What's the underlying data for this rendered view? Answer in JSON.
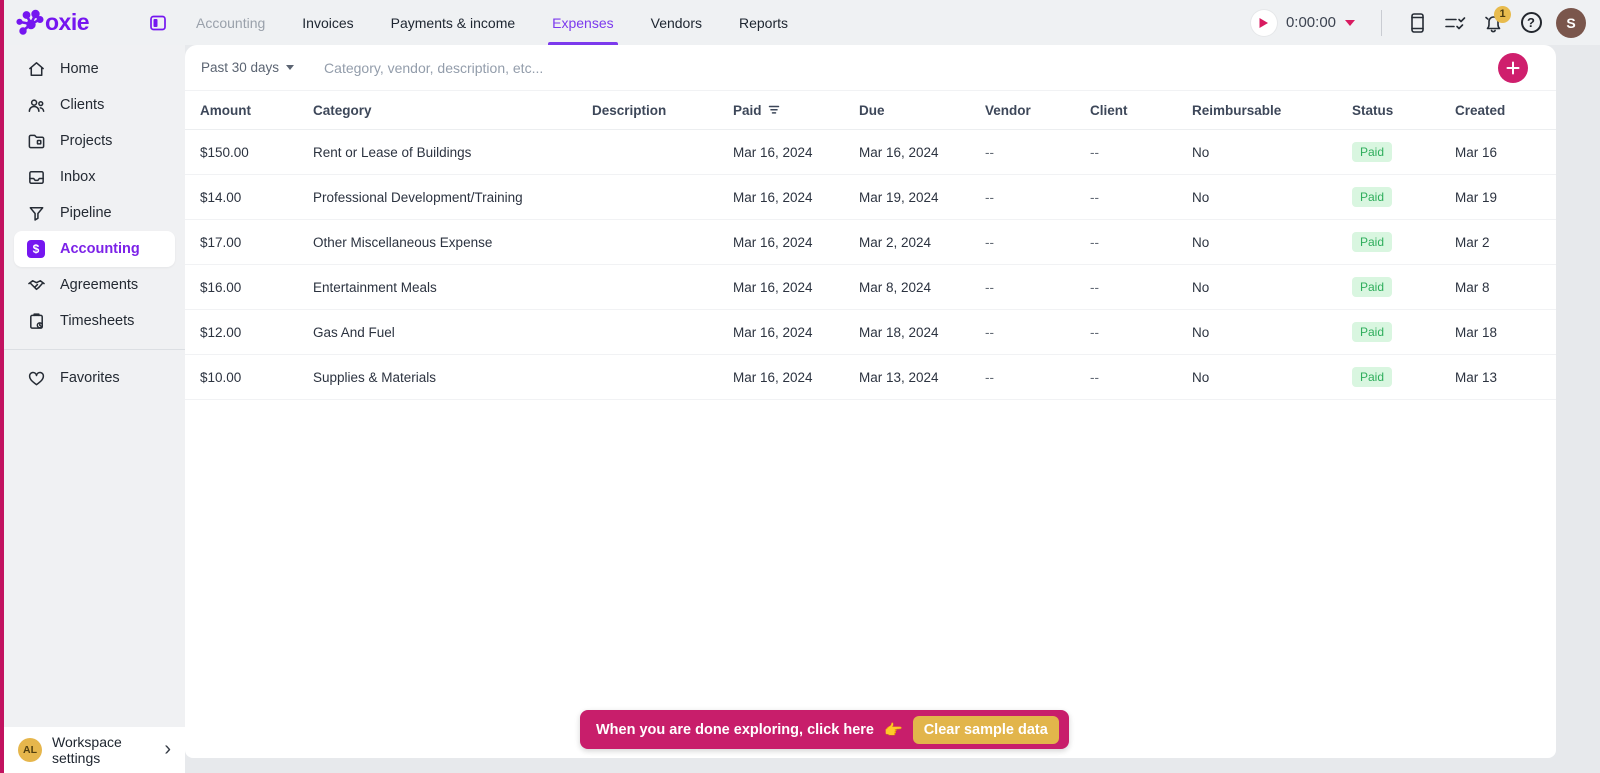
{
  "brand": {
    "name": "Moxie",
    "logo_text_part": "oxie",
    "purple": "#7516f0",
    "pink": "#c81e6b"
  },
  "topnav": {
    "items": [
      {
        "label": "Accounting"
      },
      {
        "label": "Invoices"
      },
      {
        "label": "Payments & income"
      },
      {
        "label": "Expenses"
      },
      {
        "label": "Vendors"
      },
      {
        "label": "Reports"
      }
    ],
    "active": "Expenses"
  },
  "topbar_right": {
    "timer_value": "0:00:00",
    "notification_count": "1",
    "avatar_initial": "S"
  },
  "sidebar": {
    "items": [
      {
        "label": "Home"
      },
      {
        "label": "Clients"
      },
      {
        "label": "Projects"
      },
      {
        "label": "Inbox"
      },
      {
        "label": "Pipeline"
      },
      {
        "label": "Accounting"
      },
      {
        "label": "Agreements"
      },
      {
        "label": "Timesheets"
      },
      {
        "label": "Favorites"
      }
    ],
    "active": "Accounting",
    "workspace": {
      "avatar": "AL",
      "label": "Workspace settings",
      "chevron": "›"
    }
  },
  "filters": {
    "range_label": "Past 30 days",
    "search_placeholder": "Category, vendor, description, etc..."
  },
  "table": {
    "columns": [
      "Amount",
      "Category",
      "Description",
      "Paid",
      "Due",
      "Vendor",
      "Client",
      "Reimbursable",
      "Status",
      "Created"
    ],
    "rows": [
      {
        "amount": "$150.00",
        "category": "Rent or Lease of Buildings",
        "description": "",
        "paid": "Mar 16, 2024",
        "due": "Mar 16, 2024",
        "vendor": "--",
        "client": "--",
        "reimbursable": "No",
        "status": "Paid",
        "created": "Mar 16"
      },
      {
        "amount": "$14.00",
        "category": "Professional Development/Training",
        "description": "",
        "paid": "Mar 16, 2024",
        "due": "Mar 19, 2024",
        "vendor": "--",
        "client": "--",
        "reimbursable": "No",
        "status": "Paid",
        "created": "Mar 19"
      },
      {
        "amount": "$17.00",
        "category": "Other Miscellaneous Expense",
        "description": "",
        "paid": "Mar 16, 2024",
        "due": "Mar 2, 2024",
        "vendor": "--",
        "client": "--",
        "reimbursable": "No",
        "status": "Paid",
        "created": "Mar 2"
      },
      {
        "amount": "$16.00",
        "category": "Entertainment Meals",
        "description": "",
        "paid": "Mar 16, 2024",
        "due": "Mar 8, 2024",
        "vendor": "--",
        "client": "--",
        "reimbursable": "No",
        "status": "Paid",
        "created": "Mar 8"
      },
      {
        "amount": "$12.00",
        "category": "Gas And Fuel",
        "description": "",
        "paid": "Mar 16, 2024",
        "due": "Mar 18, 2024",
        "vendor": "--",
        "client": "--",
        "reimbursable": "No",
        "status": "Paid",
        "created": "Mar 18"
      },
      {
        "amount": "$10.00",
        "category": "Supplies & Materials",
        "description": "",
        "paid": "Mar 16, 2024",
        "due": "Mar 13, 2024",
        "vendor": "--",
        "client": "--",
        "reimbursable": "No",
        "status": "Paid",
        "created": "Mar 13"
      }
    ],
    "status_color": "#2fae5c",
    "status_bg": "#d9f6e0"
  },
  "banner": {
    "message": "When you are done exploring, click here",
    "emoji": "👉",
    "button_label": "Clear sample data"
  }
}
